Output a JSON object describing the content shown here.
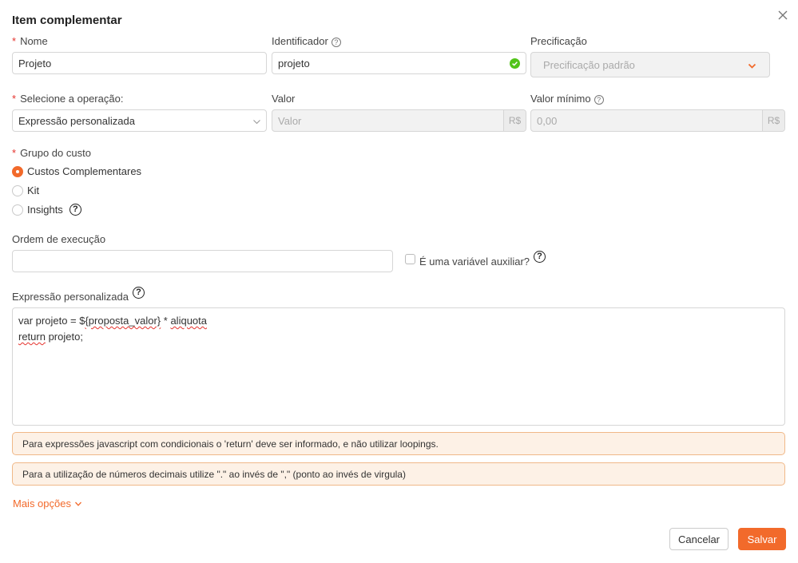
{
  "dialog": {
    "title": "Item complementar"
  },
  "fields": {
    "nome_label": "Nome",
    "nome_value": "Projeto",
    "identificador_label": "Identificador",
    "identificador_value": "projeto",
    "precificacao_label": "Precificação",
    "precificacao_placeholder": "Precificação padrão",
    "operacao_label": "Selecione a operação:",
    "operacao_value": "Expressão personalizada",
    "valor_label": "Valor",
    "valor_placeholder": "Valor",
    "valor_suffix": "R$",
    "valor_minimo_label": "Valor mínimo",
    "valor_minimo_placeholder": "0,00",
    "valor_minimo_suffix": "R$",
    "grupo_label": "Grupo do custo",
    "grupo_options": [
      "Custos Complementares",
      "Kit",
      "Insights"
    ],
    "grupo_selected": "Custos Complementares",
    "ordem_label": "Ordem de execução",
    "ordem_value": "",
    "auxiliar_label": "É uma variável auxiliar?",
    "auxiliar_checked": false,
    "expressao_label": "Expressão personalizada",
    "expressao_lines": {
      "l1_a": "var projeto = $",
      "l1_b": "{proposta_valor}",
      "l1_c": " * ",
      "l1_d": "aliquota",
      "l2_a": "return",
      "l2_b": " projeto;"
    }
  },
  "alerts": [
    "Para expressões javascript com condicionais o 'return' deve ser informado, e não utilizar loopings.",
    "Para a utilização de números decimais utilize \".\" ao invés de \",\" (ponto ao invés de virgula)"
  ],
  "more_options_label": "Mais opções",
  "buttons": {
    "cancel": "Cancelar",
    "save": "Salvar"
  },
  "required_mark": "*",
  "colors": {
    "accent": "#f26a2b",
    "required": "#e5322d",
    "success": "#52c41a",
    "alert_bg": "#fdf1e6",
    "alert_border": "#f0b888"
  }
}
